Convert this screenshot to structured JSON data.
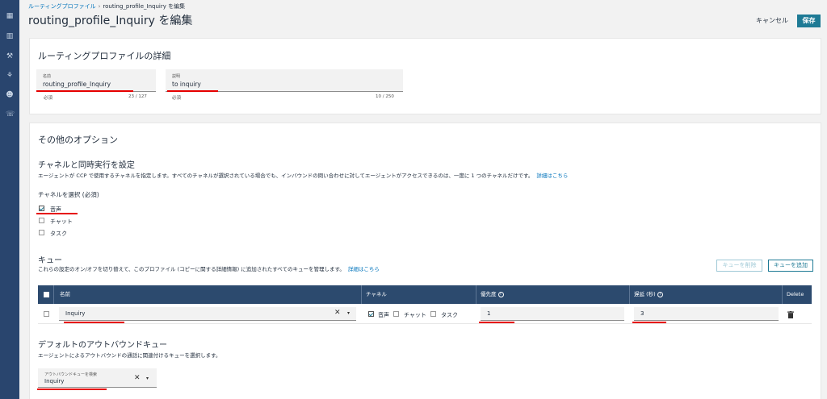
{
  "breadcrumb": {
    "parent": "ルーティングプロファイル",
    "separator": "›",
    "current": "routing_profile_Inquiry を編集"
  },
  "page_title": "routing_profile_Inquiry を編集",
  "actions": {
    "cancel": "キャンセル",
    "save": "保存"
  },
  "details": {
    "title": "ルーティングプロファイルの詳細",
    "name": {
      "label": "名前",
      "value": "routing_profile_Inquiry",
      "hint": "必須",
      "count": "23 / 127"
    },
    "description": {
      "label": "説明",
      "value": "to inquiry",
      "hint": "必須",
      "count": "10 / 250"
    }
  },
  "options": {
    "title": "その他のオプション",
    "channels": {
      "title": "チャネルと同時実行を設定",
      "desc": "エージェントが CCP で使用するチャネルを指定します。すべてのチャネルが選択されている場合でも、インバウンドの問い合わせに対してエージェントがアクセスできるのは、一度に 1 つのチャネルだけです。",
      "link": "詳細はこちら",
      "select_label": "チャネルを選択 (必須)",
      "items": [
        {
          "label": "音声",
          "checked": true
        },
        {
          "label": "チャット",
          "checked": false
        },
        {
          "label": "タスク",
          "checked": false
        }
      ]
    },
    "queues": {
      "title": "キュー",
      "desc": "これらの設定のオン/オフを切り替えて、このプロファイル (コピーに関する詳細情報) に追加されたすべてのキューを管理します。",
      "link": "詳細はこちら",
      "remove_button": "キューを削除",
      "add_button": "キューを追加",
      "columns": {
        "name": "名前",
        "channel": "チャネル",
        "priority": "優先度",
        "delay": "遅延 (秒)",
        "delete": "Delete"
      },
      "info_glyph": "i",
      "rows": [
        {
          "name": "Inquiry",
          "channels": [
            "音声",
            "チャット",
            "タスク"
          ],
          "priority": "1",
          "delay": "3"
        }
      ]
    },
    "outbound": {
      "title": "デフォルトのアウトバウンドキュー",
      "desc": "エージェントによるアウトバウンドの通話に関連付けるキューを選択します。",
      "label": "アウトバウンドキューを検索",
      "value": "Inquiry"
    }
  },
  "icons": {
    "clear": "✕",
    "dropdown": "▾",
    "accent": "#1e7a95",
    "underline": "#e60000"
  }
}
